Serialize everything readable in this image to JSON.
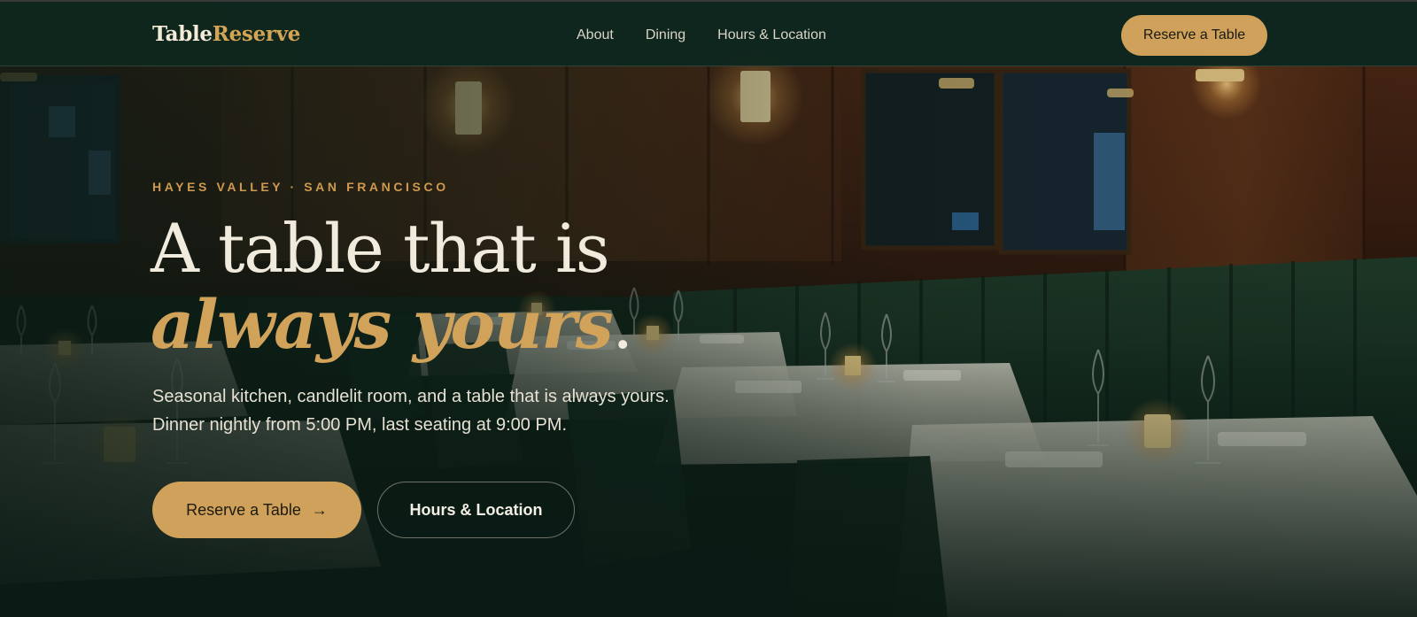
{
  "nav": {
    "logo_part1": "Table",
    "logo_part2": "Reserve",
    "links": [
      "About",
      "Dining",
      "Hours & Location"
    ],
    "cta_label": "Reserve a Table"
  },
  "hero": {
    "eyebrow": "HAYES VALLEY · SAN FRANCISCO",
    "headline_plain": "A table that is ",
    "headline_accent": "always yours",
    "headline_end": ".",
    "subtext_line1": "Seasonal kitchen, candlelit room, and a table that is always yours.",
    "subtext_line2": "Dinner nightly from 5:00 PM, last seating at 9:00 PM.",
    "primary_button": "Reserve a Table",
    "primary_button_icon": "arrow-right-icon",
    "secondary_button": "Hours & Location"
  },
  "colors": {
    "accent_gold": "#cfa15a",
    "nav_bg": "#10261e",
    "text_cream": "#f1ebdd"
  }
}
